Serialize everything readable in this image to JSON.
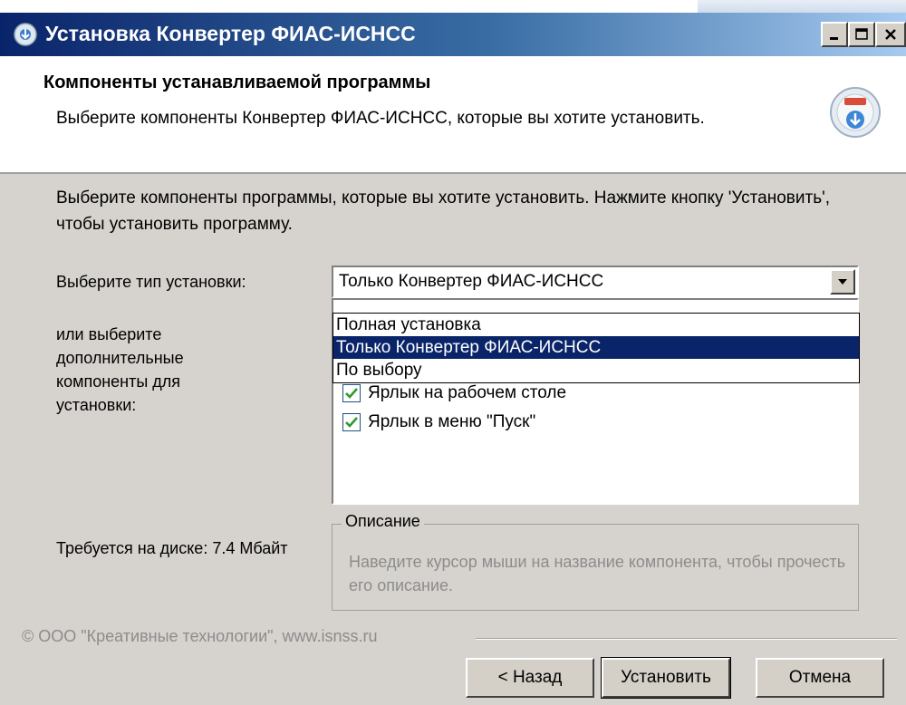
{
  "window": {
    "title": "Установка Конвертер ФИАС-ИСНСС"
  },
  "header": {
    "title": "Компоненты устанавливаемой программы",
    "subtitle": "Выберите компоненты Конвертер ФИАС-ИСНСС, которые вы хотите установить."
  },
  "main": {
    "intro": "Выберите компоненты программы, которые вы хотите установить. Нажмите кнопку 'Установить', чтобы установить программу.",
    "install_type_label": "Выберите тип установки:",
    "components_label": "или выберите дополнительные компоненты для установки:",
    "install_type_selected": "Только Конвертер ФИАС-ИСНСС",
    "install_type_options": [
      "Полная установка",
      "Только Конвертер ФИАС-ИСНСС",
      "По выбору"
    ],
    "components": [
      {
        "label": "Ярлык на рабочем столе",
        "checked": true
      },
      {
        "label": "Ярлык в меню \"Пуск\"",
        "checked": true
      }
    ],
    "disk_space": "Требуется на диске: 7.4 Мбайт",
    "description_title": "Описание",
    "description_text": "Наведите курсор мыши на название компонента, чтобы прочесть его описание."
  },
  "footer": {
    "copyright": "© ООО \"Креативные технологии\", www.isnss.ru",
    "back_label": "< Назад",
    "install_label": "Установить",
    "cancel_label": "Отмена"
  },
  "colors": {
    "title_bar": "#0a246a",
    "selection": "#0a246a",
    "checkbox_mark": "#2c9b2c"
  }
}
